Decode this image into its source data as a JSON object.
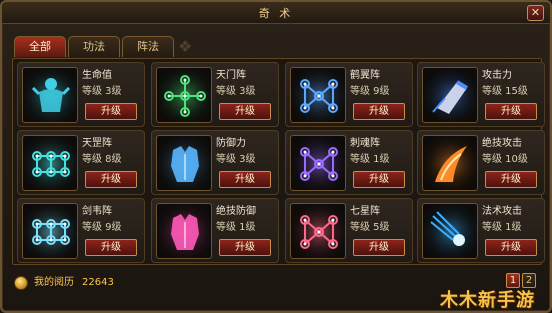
{
  "window": {
    "title": "奇 术",
    "close_glyph": "✕"
  },
  "tabs": [
    {
      "label": "全部",
      "active": true
    },
    {
      "label": "功法",
      "active": false
    },
    {
      "label": "阵法",
      "active": false
    }
  ],
  "upgrade_label": "升级",
  "skills": [
    {
      "name": "生命值",
      "level": "等级 3级",
      "icon": "warrior-figure-icon",
      "color": "#3fd0e8"
    },
    {
      "name": "天门阵",
      "level": "等级 3级",
      "icon": "cross-formation-icon",
      "color": "#4ee07a"
    },
    {
      "name": "鹤翼阵",
      "level": "等级 9级",
      "icon": "wing-formation-icon",
      "color": "#5aa8ff"
    },
    {
      "name": "攻击力",
      "level": "等级 15级",
      "icon": "gauntlet-icon",
      "color": "#4a8cff"
    },
    {
      "name": "天罡阵",
      "level": "等级 8级",
      "icon": "grid-formation-icon",
      "color": "#46e0e0"
    },
    {
      "name": "防御力",
      "level": "等级 3级",
      "icon": "armor-icon",
      "color": "#59b6ff"
    },
    {
      "name": "刺魂阵",
      "level": "等级 1级",
      "icon": "spike-formation-icon",
      "color": "#9a6cff"
    },
    {
      "name": "绝技攻击",
      "level": "等级 10级",
      "icon": "flame-slash-icon",
      "color": "#ff8a2a"
    },
    {
      "name": "剑韦阵",
      "level": "等级 9级",
      "icon": "sword-formation-icon",
      "color": "#7ae0ff"
    },
    {
      "name": "绝技防御",
      "level": "等级 1级",
      "icon": "pink-armor-icon",
      "color": "#ff5ab8"
    },
    {
      "name": "七星阵",
      "level": "等级 5级",
      "icon": "seven-star-formation-icon",
      "color": "#ff6a8a"
    },
    {
      "name": "法术攻击",
      "level": "等级 1级",
      "icon": "comet-icon",
      "color": "#3ab0ff"
    }
  ],
  "footer": {
    "exp_label": "我的阅历",
    "exp_value": "22643",
    "pages": [
      "1",
      "2"
    ],
    "current_page": "1"
  },
  "watermark": "木木新手游"
}
